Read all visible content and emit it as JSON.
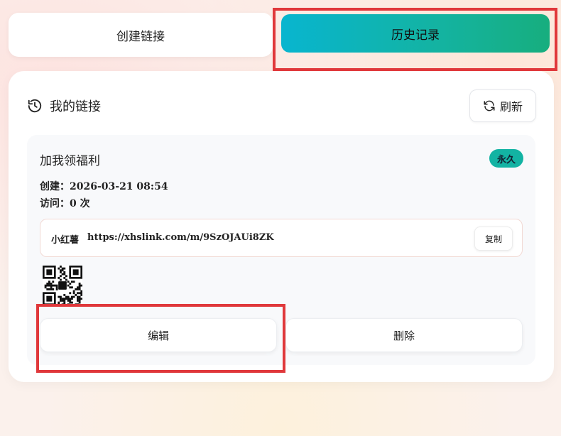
{
  "tabs": {
    "create_label": "创建链接",
    "history_label": "历史记录"
  },
  "card": {
    "title": "我的链接",
    "refresh_label": "刷新"
  },
  "link": {
    "name": "加我领福利",
    "badge": "永久",
    "created_label": "创建：2026-03-21 08:54",
    "visits_label": "访问：0 次",
    "platform": "小红薯",
    "url": "https://xhslink.com/m/9SzOJAUi8ZK",
    "copy_label": "复制",
    "edit_label": "编辑",
    "delete_label": "删除"
  },
  "icons": {
    "history": "history-icon",
    "refresh": "refresh-icon",
    "qr": "qr-code"
  },
  "colors": {
    "accent_start": "#08b5cf",
    "accent_end": "#17ae7e",
    "badge": "#13b3a3",
    "highlight": "#e0383b"
  }
}
